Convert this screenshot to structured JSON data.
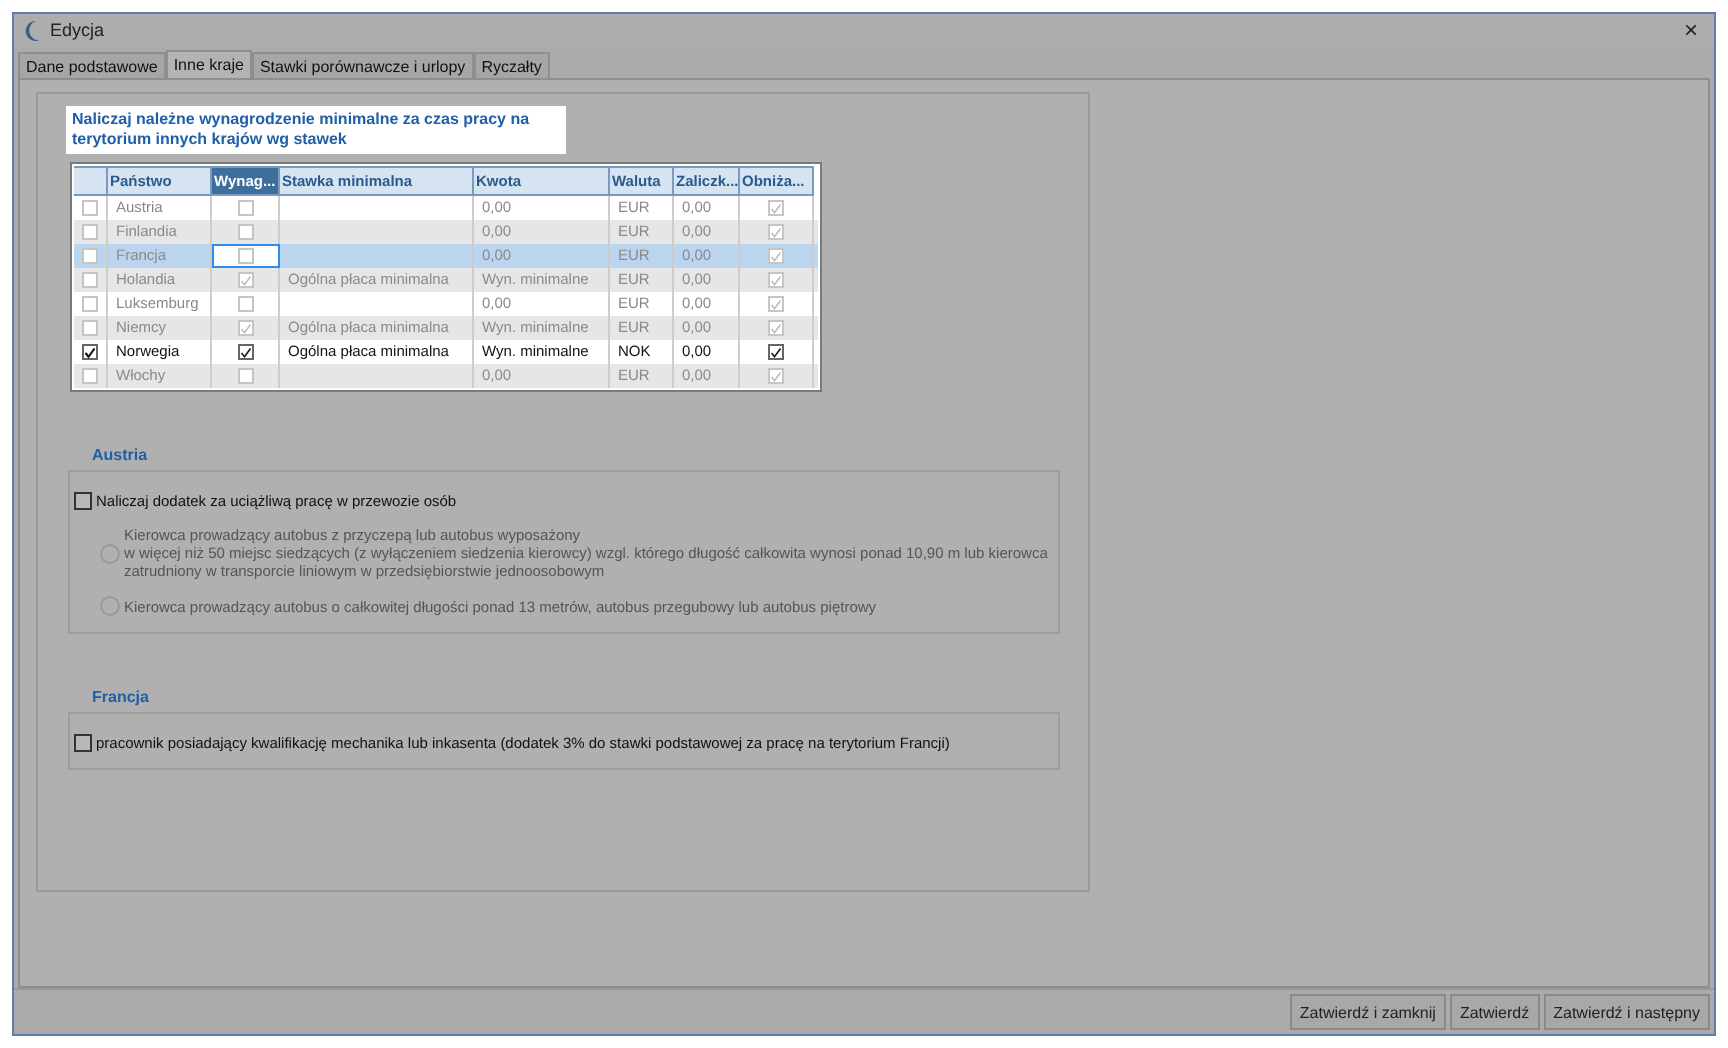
{
  "window": {
    "title": "Edycja",
    "close": "×"
  },
  "tabs": [
    {
      "label": "Dane podstawowe",
      "selected": false
    },
    {
      "label": "Inne kraje",
      "selected": true
    },
    {
      "label": "Stawki porównawcze i urlopy",
      "selected": false
    },
    {
      "label": "Ryczałty",
      "selected": false
    }
  ],
  "intro": "Naliczaj należne wynagrodzenie minimalne za czas pracy na terytorium innych krajów wg stawek",
  "table": {
    "columns": [
      {
        "label": "Państwo",
        "selected": false
      },
      {
        "label": "Wynag...",
        "selected": true
      },
      {
        "label": "Stawka minimalna",
        "selected": false
      },
      {
        "label": "Kwota",
        "selected": false
      },
      {
        "label": "Waluta",
        "selected": false
      },
      {
        "label": "Zaliczk...",
        "selected": false
      },
      {
        "label": "Obniża...",
        "selected": false
      }
    ],
    "rows": [
      {
        "checked": false,
        "disabled": true,
        "selected": false,
        "country": "Austria",
        "wage": false,
        "rate": "",
        "amount": "0,00",
        "currency": "EUR",
        "advance": "0,00",
        "reduce": true
      },
      {
        "checked": false,
        "disabled": true,
        "selected": false,
        "country": "Finlandia",
        "wage": false,
        "rate": "",
        "amount": "0,00",
        "currency": "EUR",
        "advance": "0,00",
        "reduce": true
      },
      {
        "checked": false,
        "disabled": true,
        "selected": true,
        "country": "Francja",
        "wage": false,
        "rate": "",
        "amount": "0,00",
        "currency": "EUR",
        "advance": "0,00",
        "reduce": true
      },
      {
        "checked": false,
        "disabled": true,
        "selected": false,
        "country": "Holandia",
        "wage": true,
        "rate": "Ogólna płaca minimalna",
        "amount": "Wyn. minimalne",
        "currency": "EUR",
        "advance": "0,00",
        "reduce": true
      },
      {
        "checked": false,
        "disabled": true,
        "selected": false,
        "country": "Luksemburg",
        "wage": false,
        "rate": "",
        "amount": "0,00",
        "currency": "EUR",
        "advance": "0,00",
        "reduce": true
      },
      {
        "checked": false,
        "disabled": true,
        "selected": false,
        "country": "Niemcy",
        "wage": true,
        "rate": "Ogólna płaca minimalna",
        "amount": "Wyn. minimalne",
        "currency": "EUR",
        "advance": "0,00",
        "reduce": true
      },
      {
        "checked": true,
        "disabled": false,
        "selected": false,
        "country": "Norwegia",
        "wage": true,
        "rate": "Ogólna płaca minimalna",
        "amount": "Wyn. minimalne",
        "currency": "NOK",
        "advance": "0,00",
        "reduce": true
      },
      {
        "checked": false,
        "disabled": true,
        "selected": false,
        "country": "Włochy",
        "wage": false,
        "rate": "",
        "amount": "0,00",
        "currency": "EUR",
        "advance": "0,00",
        "reduce": true
      }
    ]
  },
  "sections": [
    {
      "title": "Austria",
      "items": [
        {
          "kind": "checkbox",
          "label": "Naliczaj dodatek za uciążliwą pracę w przewozie osób",
          "checked": false,
          "disabled": false
        },
        {
          "kind": "radio",
          "label": "Kierowca prowadzący autobus z przyczepą lub autobus wyposażony\nw więcej niż 50 miejsc siedzących (z wyłączeniem siedzenia kierowcy) wzgl. którego długość całkowita wynosi ponad 10,90 m lub kierowca\nzatrudniony w transporcie liniowym w przedsiębiorstwie jednoosobowym",
          "checked": false,
          "disabled": true
        },
        {
          "kind": "radio",
          "label": "Kierowca prowadzący autobus o całkowitej długości ponad 13 metrów, autobus przegubowy lub autobus piętrowy",
          "checked": false,
          "disabled": true
        }
      ]
    },
    {
      "title": "Francja",
      "items": [
        {
          "kind": "checkbox",
          "label": "pracownik posiadający kwalifikację mechanika lub inkasenta (dodatek 3% do stawki podstawowej za pracę na terytorium Francji)",
          "checked": false,
          "disabled": false
        }
      ]
    }
  ],
  "buttons": [
    "Zatwierdź i zamknij",
    "Zatwierdź",
    "Zatwierdź i następny"
  ]
}
